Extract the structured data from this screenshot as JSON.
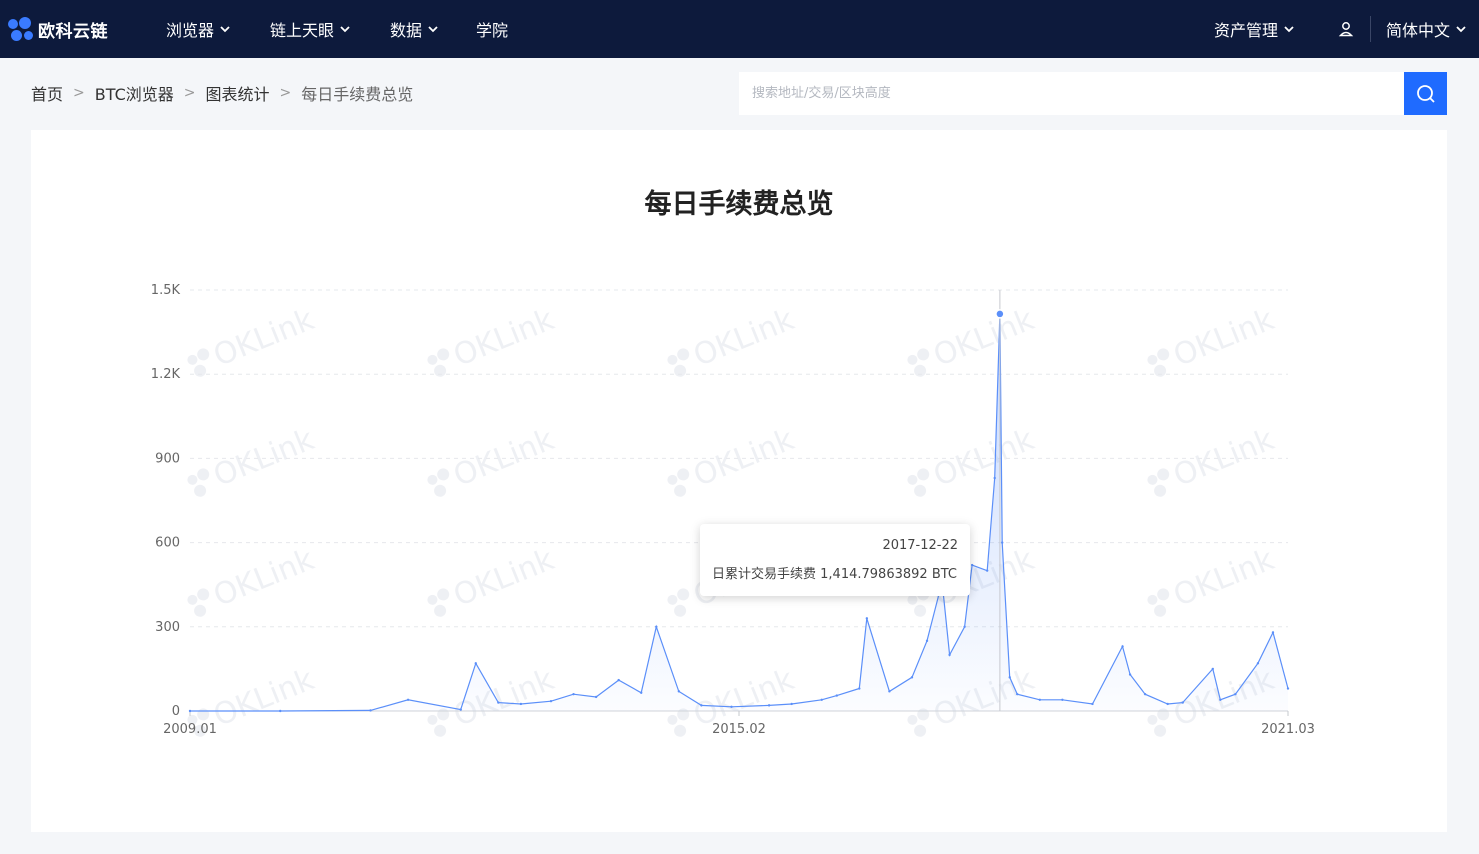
{
  "nav": {
    "logo_text": "欧科云链",
    "items": [
      {
        "label": "浏览器",
        "dropdown": true
      },
      {
        "label": "链上天眼",
        "dropdown": true
      },
      {
        "label": "数据",
        "dropdown": true
      },
      {
        "label": "学院",
        "dropdown": false
      }
    ],
    "asset_mgmt": "资产管理",
    "user_icon": "user-icon",
    "language": "简体中文",
    "colors": {
      "bg": "#0d1a3c",
      "accent": "#1f6bff"
    }
  },
  "breadcrumb": [
    "首页",
    "BTC浏览器",
    "图表统计",
    "每日手续费总览"
  ],
  "search": {
    "placeholder": "搜索地址/交易/区块高度",
    "icon": "search-icon"
  },
  "chart_data": {
    "type": "area",
    "title": "每日手续费总览",
    "xlabel": "",
    "ylabel": "",
    "x_ticks": [
      "2009.01",
      "2015.02",
      "2021.03"
    ],
    "y_ticks": [
      "0",
      "300",
      "600",
      "900",
      "1.2K",
      "1.5K"
    ],
    "ylim": [
      0,
      1500
    ],
    "xlim": [
      "2009-01",
      "2021-03"
    ],
    "grid": true,
    "watermark": "OKLink",
    "series": [
      {
        "name": "日累计交易手续费",
        "unit": "BTC",
        "color": "#5b8ff9",
        "x": [
          "2009-01",
          "2010-01",
          "2011-01",
          "2011-06",
          "2012-01",
          "2012-03",
          "2012-06",
          "2012-09",
          "2013-01",
          "2013-04",
          "2013-07",
          "2013-10",
          "2014-01",
          "2014-03",
          "2014-06",
          "2014-09",
          "2015-01",
          "2015-06",
          "2015-09",
          "2016-01",
          "2016-03",
          "2016-06",
          "2016-07",
          "2016-10",
          "2017-01",
          "2017-03",
          "2017-05",
          "2017-06",
          "2017-08",
          "2017-09",
          "2017-11",
          "2017-12",
          "2017-12-22",
          "2018-01",
          "2018-02",
          "2018-03",
          "2018-06",
          "2018-09",
          "2019-01",
          "2019-05",
          "2019-06",
          "2019-08",
          "2019-11",
          "2020-01",
          "2020-05",
          "2020-06",
          "2020-08",
          "2020-11",
          "2021-01",
          "2021-03"
        ],
        "values": [
          0,
          0,
          2,
          40,
          5,
          170,
          30,
          25,
          35,
          60,
          50,
          110,
          65,
          300,
          70,
          20,
          15,
          20,
          25,
          40,
          55,
          80,
          330,
          70,
          120,
          250,
          460,
          200,
          300,
          520,
          500,
          830,
          1414.8,
          600,
          120,
          60,
          40,
          40,
          25,
          230,
          130,
          60,
          25,
          30,
          150,
          40,
          60,
          170,
          280,
          80
        ]
      }
    ]
  },
  "tooltip": {
    "date": "2017-12-22",
    "label": "日累计交易手续费",
    "value": "1,414.79863892",
    "unit": "BTC"
  }
}
